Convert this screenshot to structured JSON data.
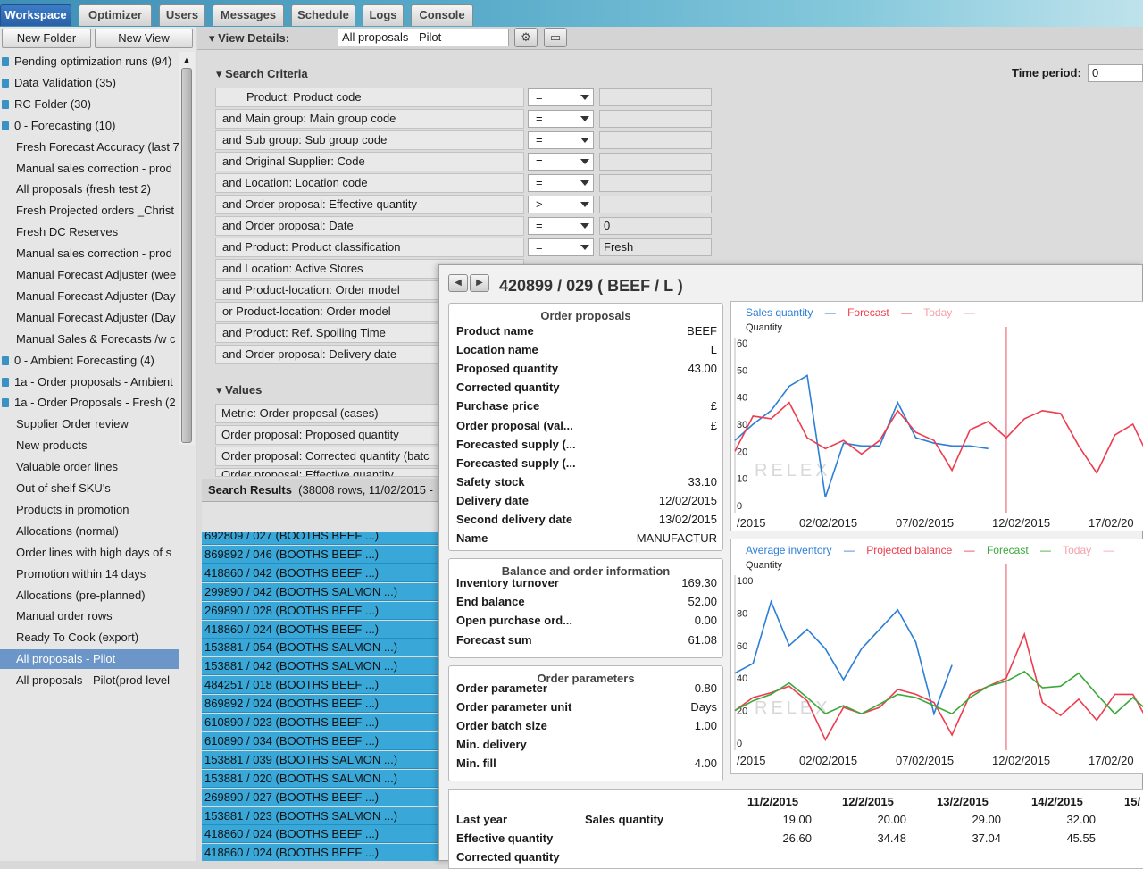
{
  "tabs": [
    "Workspace",
    "Optimizer",
    "Users",
    "Messages",
    "Schedule",
    "Logs",
    "Console"
  ],
  "left": {
    "new_folder": "New Folder",
    "new_view": "New View",
    "items": [
      {
        "label": "Pending optimization runs (94)",
        "icon": true
      },
      {
        "label": "Data Validation (35)",
        "icon": true
      },
      {
        "label": "RC Folder (30)",
        "icon": true
      },
      {
        "label": "0 - Forecasting (10)",
        "icon": true
      },
      {
        "label": "Fresh Forecast Accuracy (last 7"
      },
      {
        "label": "Manual sales correction - prod"
      },
      {
        "label": "All proposals (fresh test 2)"
      },
      {
        "label": "Fresh Projected orders _Christ"
      },
      {
        "label": "Fresh DC Reserves"
      },
      {
        "label": "Manual sales correction - prod"
      },
      {
        "label": "Manual Forecast Adjuster (wee"
      },
      {
        "label": "Manual Forecast Adjuster (Day"
      },
      {
        "label": "Manual Forecast Adjuster (Day"
      },
      {
        "label": "Manual Sales & Forecasts /w c"
      },
      {
        "label": "0 - Ambient Forecasting (4)",
        "icon": true
      },
      {
        "label": "1a - Order proposals - Ambient",
        "icon": true
      },
      {
        "label": "1a - Order Proposals - Fresh (2",
        "icon": true
      },
      {
        "label": "Supplier Order review"
      },
      {
        "label": "New products"
      },
      {
        "label": "Valuable order lines"
      },
      {
        "label": "Out of shelf SKU's"
      },
      {
        "label": "Products in promotion"
      },
      {
        "label": "Allocations (normal)"
      },
      {
        "label": "Order lines with high days of s"
      },
      {
        "label": "Promotion within 14 days"
      },
      {
        "label": "Allocations (pre-planned)"
      },
      {
        "label": "Manual order rows"
      },
      {
        "label": "Ready To Cook (export)"
      },
      {
        "label": "All proposals - Pilot",
        "selected": true
      },
      {
        "label": "All proposals - Pilot(prod level"
      }
    ]
  },
  "view_details": {
    "label": "View Details:",
    "value": "All proposals - Pilot",
    "gear": "⚙",
    "monitor": "▭"
  },
  "search_criteria": {
    "title": "Search Criteria",
    "time_label": "Time period:",
    "time_value": "0",
    "rows": [
      {
        "label": "Product: Product code",
        "op": "=",
        "val": ""
      },
      {
        "label": "and Main group: Main group code",
        "op": "=",
        "val": ""
      },
      {
        "label": "and Sub group: Sub group code",
        "op": "=",
        "val": ""
      },
      {
        "label": "and Original Supplier: Code",
        "op": "=",
        "val": ""
      },
      {
        "label": "and Location: Location code",
        "op": "=",
        "val": ""
      },
      {
        "label": "and Order proposal: Effective quantity",
        "op": ">",
        "val": ""
      },
      {
        "label": "and Order proposal: Date",
        "op": "=",
        "val": "0"
      },
      {
        "label": "and Product: Product classification",
        "op": "=",
        "val": "Fresh"
      },
      {
        "label": "and Location: Active Stores",
        "op": "",
        "val": ""
      },
      {
        "label": "and Product-location: Order model",
        "op": "",
        "val": ""
      },
      {
        "label": "or    Product-location: Order model",
        "op": "",
        "val": ""
      },
      {
        "label": "and Product: Ref. Spoiling Time",
        "op": "",
        "val": ""
      },
      {
        "label": "and Order proposal: Delivery date",
        "op": "",
        "val": ""
      }
    ]
  },
  "values_section": {
    "title": "Values",
    "rows": [
      "Metric: Order proposal (cases)",
      "Order proposal: Proposed quantity",
      "Order proposal: Corrected quantity (batc",
      "Order proposal: Effective quantity"
    ]
  },
  "search_results": {
    "title": "Search Results",
    "info": "(38008 rows, 11/02/2015 -",
    "rows": [
      "692809 / 027 (BOOTHS BEEF ...)",
      "869892 / 046 (BOOTHS BEEF ...)",
      "418860 / 042 (BOOTHS BEEF ...)",
      "299890 / 042 (BOOTHS SALMON ...)",
      "269890 / 028 (BOOTHS BEEF ...)",
      "418860 / 024 (BOOTHS BEEF ...)",
      "153881 / 054 (BOOTHS SALMON ...)",
      "153881 / 042 (BOOTHS SALMON ...)",
      "484251 / 018 (BOOTHS BEEF ...)",
      "869892 / 024 (BOOTHS BEEF ...)",
      "610890 / 023 (BOOTHS BEEF ...)",
      "610890 / 034 (BOOTHS BEEF ...)",
      "153881 / 039 (BOOTHS SALMON ...)",
      "153881 / 020 (BOOTHS SALMON ...)",
      "269890 / 027 (BOOTHS BEEF ...)",
      "153881 / 023 (BOOTHS SALMON ...)",
      "418860 / 024 (BOOTHS BEEF ...)",
      "418860 / 024 (BOOTHS BEEF ...)"
    ]
  },
  "popup": {
    "title": "420899 / 029 ( BEEF / L )",
    "prev": "◀",
    "next": "▶",
    "order_proposals": {
      "title": "Order proposals",
      "rows": [
        {
          "k": "Product name",
          "v": "BEEF"
        },
        {
          "k": "Location name",
          "v": "L"
        },
        {
          "k": "Proposed quantity",
          "v": "43.00"
        },
        {
          "k": "Corrected quantity",
          "v": ""
        },
        {
          "k": "Purchase price",
          "v": "£"
        },
        {
          "k": "Order proposal (val...",
          "v": "£"
        },
        {
          "k": "Forecasted supply (...",
          "v": ""
        },
        {
          "k": "Forecasted supply (...",
          "v": ""
        },
        {
          "k": "Safety stock",
          "v": "33.10"
        },
        {
          "k": "Delivery date",
          "v": "12/02/2015"
        },
        {
          "k": "Second delivery date",
          "v": "13/02/2015"
        },
        {
          "k": "Name",
          "v": "MANUFACTUR"
        }
      ]
    },
    "balance": {
      "title": "Balance and order information",
      "rows": [
        {
          "k": "Inventory turnover",
          "v": "169.30"
        },
        {
          "k": "End balance",
          "v": "52.00"
        },
        {
          "k": "Open purchase ord...",
          "v": "0.00"
        },
        {
          "k": "Forecast sum",
          "v": "61.08"
        }
      ]
    },
    "params": {
      "title": "Order parameters",
      "rows": [
        {
          "k": "Order parameter",
          "v": "0.80"
        },
        {
          "k": "Order parameter unit",
          "v": "Days"
        },
        {
          "k": "Order batch size",
          "v": "1.00"
        },
        {
          "k": "Min. delivery",
          "v": ""
        },
        {
          "k": "Min. fill",
          "v": "4.00"
        }
      ]
    },
    "table": {
      "dates": [
        "11/2/2015",
        "12/2/2015",
        "13/2/2015",
        "14/2/2015",
        "15/"
      ],
      "rows": [
        {
          "a": "Last year",
          "b": "Sales quantity",
          "vals": [
            "19.00",
            "20.00",
            "29.00",
            "32.00"
          ]
        },
        {
          "a": "Effective quantity",
          "b": "",
          "vals": [
            "26.60",
            "34.48",
            "37.04",
            "45.55"
          ]
        },
        {
          "a": "Corrected quantity",
          "b": "",
          "vals": []
        }
      ]
    }
  },
  "chart_data": [
    {
      "type": "line",
      "legend": [
        "Sales quantity",
        "Forecast",
        "Today"
      ],
      "ylabel": "Quantity",
      "ylim": [
        0,
        60
      ],
      "yticks": [
        "60",
        "50",
        "40",
        "30",
        "20",
        "10",
        "0"
      ],
      "xticks": [
        "/2015",
        "02/02/2015",
        "07/02/2015",
        "12/02/2015",
        "17/02/20"
      ],
      "colors": {
        "sales": "#2b7fd6",
        "forecast": "#ee3c4e",
        "today": "#f4a0a8",
        "avg": "#2b7fd6",
        "proj": "#ee3c4e",
        "fc": "#3aa83a"
      },
      "watermark": "RELEX",
      "x": [
        0,
        1,
        2,
        3,
        4,
        5,
        6,
        7,
        8,
        9,
        10,
        11,
        12,
        13,
        14,
        15,
        16,
        17,
        18,
        19,
        20,
        21,
        22,
        23
      ],
      "series": [
        {
          "name": "Sales quantity",
          "values": [
            24,
            30,
            35,
            44,
            48,
            3,
            23,
            22,
            22,
            38,
            25,
            23,
            22,
            22,
            21,
            null,
            null,
            null,
            null,
            null,
            null,
            null,
            null,
            null
          ]
        },
        {
          "name": "Forecast",
          "values": [
            20,
            33,
            32,
            38,
            25,
            21,
            24,
            19,
            24,
            35,
            27,
            24,
            13,
            28,
            31,
            25,
            32,
            35,
            34,
            22,
            12,
            26,
            30,
            16
          ]
        }
      ],
      "today_x": 15
    },
    {
      "type": "line",
      "legend": [
        "Average inventory",
        "Projected balance",
        "Forecast",
        "Today"
      ],
      "ylabel": "Quantity",
      "ylim": [
        0,
        100
      ],
      "yticks": [
        "100",
        "80",
        "60",
        "40",
        "20",
        "0"
      ],
      "xticks": [
        "/2015",
        "02/02/2015",
        "07/02/2015",
        "12/02/2015",
        "17/02/20"
      ],
      "watermark": "RELEX",
      "x": [
        0,
        1,
        2,
        3,
        4,
        5,
        6,
        7,
        8,
        9,
        10,
        11,
        12,
        13,
        14,
        15,
        16,
        17,
        18,
        19,
        20,
        21,
        22,
        23
      ],
      "series": [
        {
          "name": "Average inventory",
          "values": [
            43,
            49,
            87,
            60,
            70,
            58,
            39,
            58,
            70,
            82,
            62,
            18,
            48,
            null,
            null,
            null,
            null,
            null,
            null,
            null,
            null,
            null,
            null,
            null
          ]
        },
        {
          "name": "Projected balance",
          "values": [
            20,
            28,
            31,
            35,
            26,
            2,
            22,
            18,
            22,
            33,
            30,
            25,
            5,
            30,
            35,
            40,
            67,
            25,
            17,
            27,
            14,
            30,
            30,
            10
          ]
        },
        {
          "name": "Forecast",
          "values": [
            20,
            26,
            30,
            37,
            28,
            18,
            23,
            18,
            24,
            30,
            28,
            23,
            18,
            28,
            35,
            38,
            44,
            34,
            35,
            43,
            30,
            18,
            28,
            18
          ]
        }
      ],
      "today_x": 15
    }
  ]
}
